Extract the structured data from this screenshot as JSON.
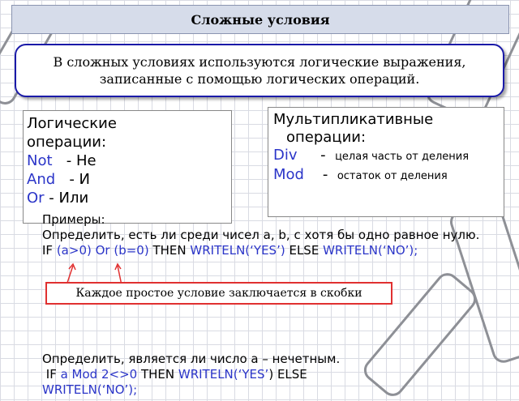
{
  "title": "Сложные условия",
  "intro": "В сложных условиях используются логические выражения, записанные с помощью логических операций.",
  "logic_box": {
    "heading_line1": "Логические",
    "heading_line2": "операции:",
    "items": [
      {
        "op": "Not",
        "sep": " - ",
        "desc": "Не"
      },
      {
        "op": "And",
        "sep": " - ",
        "desc": "И"
      },
      {
        "op": "Or",
        "sep": " - ",
        "desc": "Или"
      }
    ]
  },
  "mult_box": {
    "heading_line1": "Мультипликативные",
    "heading_line2": "операции:",
    "items": [
      {
        "op": "Div",
        "sep": "-",
        "desc": "целая часть от деления"
      },
      {
        "op": "Mod",
        "sep": "-",
        "desc": "остаток от деления"
      }
    ]
  },
  "examples": {
    "label": "Примеры:",
    "task1": "Определить, есть ли среди чисел a, b, с хотя бы одно равное нулю.",
    "code1": {
      "if": "IF ",
      "cond1": "(a>0)",
      "or": " Or ",
      "cond2": "(b=0)",
      "then": " THEN ",
      "call1": "WRITELN(‘YES’)",
      "else": " ELSE ",
      "call2": "WRITELN(‘NO’);"
    },
    "note": "Каждое простое условие заключается в скобки",
    "task2": "Определить, является ли число а – нечетным.",
    "code2": {
      "if": " IF ",
      "cond": "a Mod 2<>0",
      "then": " THEN ",
      "call1": "WRITELN(‘YES’",
      "rest": ") ELSE",
      "call2": "WRITELN(‘NO’);"
    }
  },
  "colors": {
    "keyword": "#2b35c8",
    "note_border": "#e03030",
    "frame": "#1a1aa8",
    "arrow": "#e03030"
  }
}
